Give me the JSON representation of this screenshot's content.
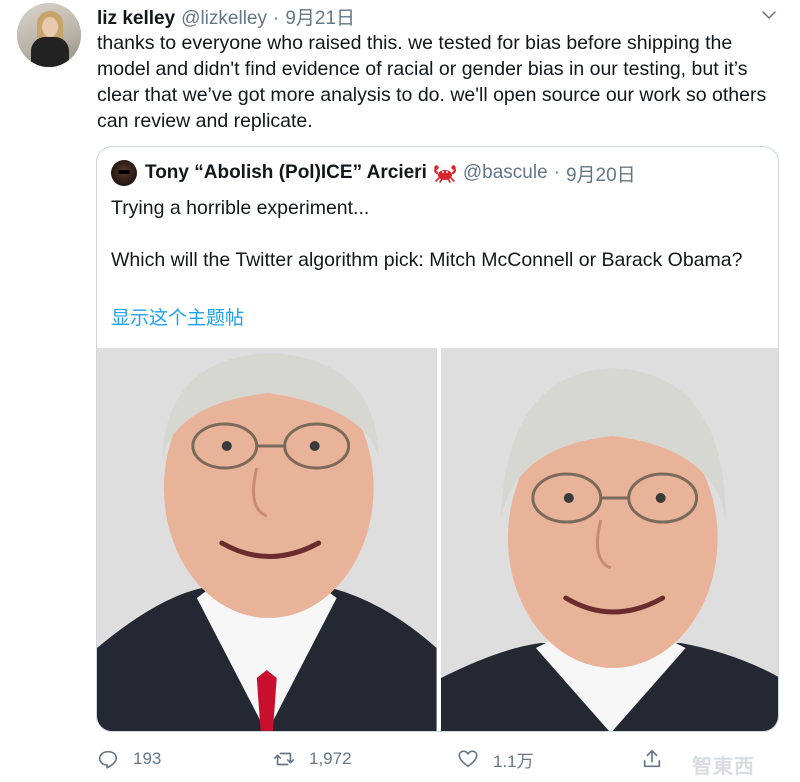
{
  "tweet": {
    "display_name": "liz kelley",
    "handle": "@lizkelley",
    "separator": "·",
    "date": "9月21日",
    "text": "thanks to everyone who raised this. we tested for bias before shipping the model and didn't find evidence of racial or gender bias in our testing, but it’s clear that we’ve got more analysis to do. we'll open source our work so others can review and replicate."
  },
  "quoted_tweet": {
    "display_name": "Tony “Abolish (Pol)ICE” Arcieri",
    "emoji_icon": "crab-emoji",
    "handle": "@bascule",
    "separator": "·",
    "date": "9月20日",
    "line1": "Trying a horrible experiment...",
    "line2": "Which will the Twitter algorithm pick: Mitch McConnell or Barack Obama?",
    "show_thread": "显示这个主题帖",
    "photos": [
      "portrait-photo-left",
      "portrait-photo-right"
    ]
  },
  "actions": {
    "reply_count": "193",
    "retweet_count": "1,972",
    "like_count": "1.1万",
    "reply_icon": "reply-icon",
    "retweet_icon": "retweet-icon",
    "like_icon": "heart-icon",
    "share_icon": "share-icon"
  },
  "watermark": "智東西",
  "colors": {
    "link": "#1da1f2",
    "secondary_text": "#657786",
    "border": "#ccd6dd"
  }
}
